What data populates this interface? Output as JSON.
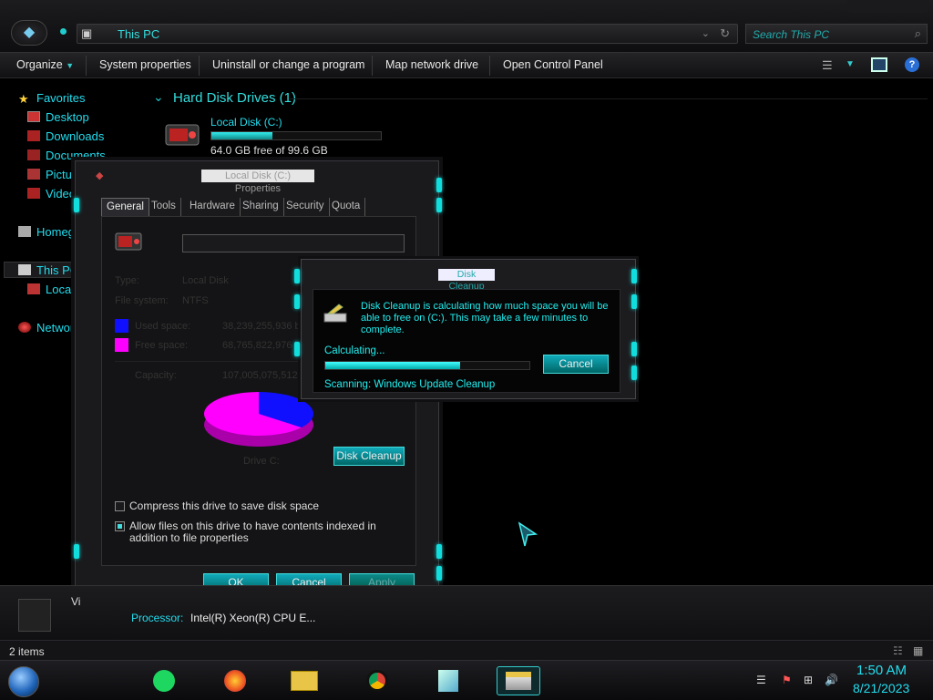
{
  "address": {
    "text": "This PC",
    "search_placeholder": "Search This PC"
  },
  "toolbar": {
    "organize": "Organize",
    "system_properties": "System properties",
    "uninstall": "Uninstall or change a program",
    "map_drive": "Map network drive",
    "control_panel": "Open Control Panel"
  },
  "nav": {
    "favorites": "Favorites",
    "desktop": "Desktop",
    "downloads": "Downloads",
    "documents": "Documents",
    "pictures": "Pictu",
    "videos": "Video",
    "homegroup": "Homeg",
    "this_pc": "This PC",
    "local": "Local",
    "network": "Network"
  },
  "content": {
    "group_header": "Hard Disk Drives (1)",
    "drive_name": "Local Disk (C:)",
    "drive_free_text": "64.0 GB free of 99.6 GB",
    "drive_used_fraction": 0.36
  },
  "properties": {
    "title": "Local Disk (C:) Properties",
    "tabs": [
      "General",
      "Tools",
      "Hardware",
      "Sharing",
      "Security",
      "Quota"
    ],
    "type_label": "Type:",
    "type_value": "Local Disk",
    "fs_label": "File system:",
    "fs_value": "NTFS",
    "used_label": "Used space:",
    "used_value": "38,239,255,936 b",
    "free_label": "Free space:",
    "free_value": "68,765,822,976 b",
    "capacity_label": "Capacity:",
    "capacity_value": "107,005,075,512 b",
    "drive_label": "Drive C:",
    "disk_cleanup": "Disk Cleanup",
    "compress": "Compress this drive to save disk space",
    "index": "Allow files on this drive to have contents indexed in addition to file properties",
    "ok": "OK",
    "cancel": "Cancel",
    "apply": "Apply",
    "used_color": "#1010ff",
    "free_color": "#ff00ff"
  },
  "disk_cleanup": {
    "title": "Disk Cleanup",
    "message": "Disk Cleanup is calculating how much space you will be able to free on  (C:). This may take a few minutes to complete.",
    "calculating": "Calculating...",
    "progress_fraction": 0.66,
    "cancel": "Cancel",
    "scanning": "Scanning:  Windows Update Cleanup"
  },
  "details": {
    "truncated": "Vi",
    "processor_label": "Processor:",
    "processor_value": "Intel(R) Xeon(R) CPU E..."
  },
  "status": {
    "items": "2 items"
  },
  "clock": {
    "time": "1:50 AM",
    "date": "8/21/2023"
  },
  "accent": "#22dddd"
}
